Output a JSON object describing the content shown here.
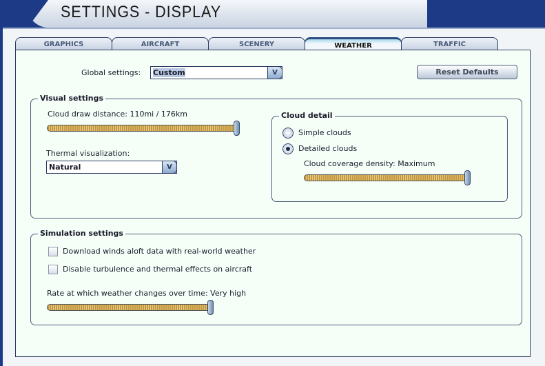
{
  "title": "SETTINGS - DISPLAY",
  "tabs": [
    {
      "label": "GRAPHICS"
    },
    {
      "label": "AIRCRAFT"
    },
    {
      "label": "SCENERY"
    },
    {
      "label": "WEATHER",
      "active": true
    },
    {
      "label": "TRAFFIC"
    }
  ],
  "global": {
    "label": "Global settings:",
    "value": "Custom"
  },
  "reset_label": "Reset Defaults",
  "visual": {
    "title": "Visual settings",
    "cloud_draw_label": "Cloud draw distance: 110mi / 176km",
    "cloud_draw_value": 1.0,
    "thermal_label": "Thermal visualization:",
    "thermal_value": "Natural"
  },
  "cloud_detail": {
    "title": "Cloud detail",
    "simple": "Simple clouds",
    "detailed": "Detailed clouds",
    "selected": "detailed",
    "density_label": "Cloud coverage density: Maximum",
    "density_value": 1.0
  },
  "simulation": {
    "title": "Simulation settings",
    "winds_label": "Download winds aloft data with real-world weather",
    "winds_checked": false,
    "turbulence_label": "Disable turbulence and thermal effects on aircraft",
    "turbulence_checked": false,
    "rate_label": "Rate at which weather changes over time: Very high",
    "rate_value": 1.0
  }
}
